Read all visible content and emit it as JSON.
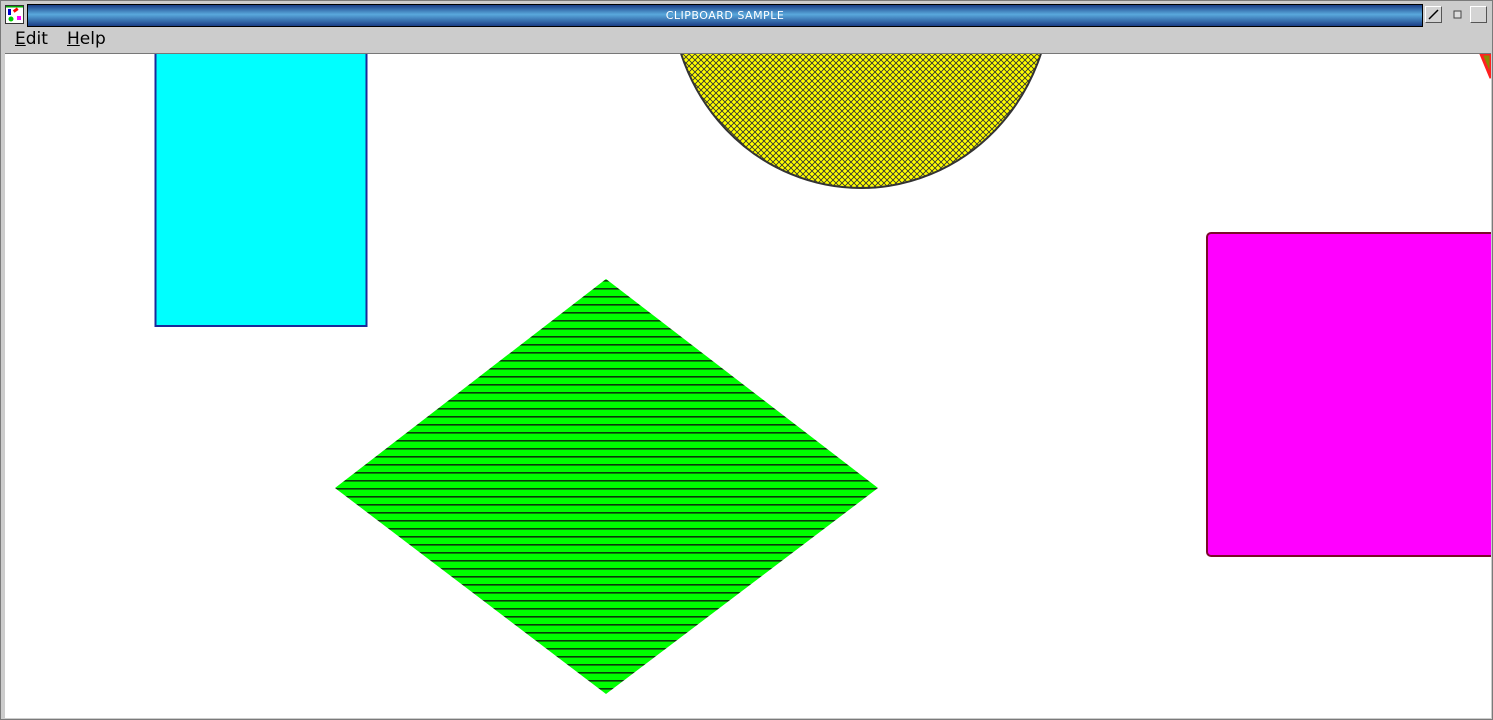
{
  "window": {
    "title": "CLIPBOARD SAMPLE",
    "controls": [
      "minimize-button",
      "restore-button",
      "maximize-button"
    ]
  },
  "menu": {
    "items": [
      {
        "label": "Edit",
        "mnemonic": "E",
        "rest": "dit"
      },
      {
        "label": "Help",
        "mnemonic": "H",
        "rest": "elp"
      }
    ]
  },
  "shapes": {
    "colors": {
      "rectangle": "#00ffff",
      "rectangle_border": "#1a2a9a",
      "ellipse": "#ffff00",
      "diamond": "#00ff00",
      "square": "#ff00ff",
      "square_border": "#7a0a2a"
    }
  }
}
